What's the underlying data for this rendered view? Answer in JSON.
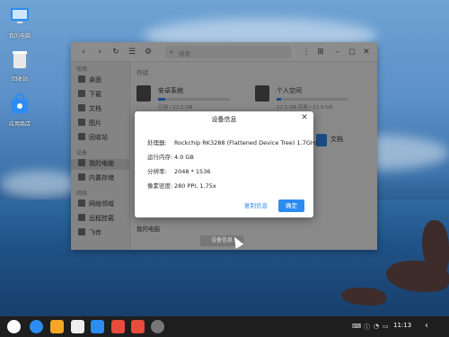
{
  "desktop": {
    "icons": [
      {
        "label": "我的电脑",
        "icon": "computer-icon"
      },
      {
        "label": "回收站",
        "icon": "trash-icon"
      },
      {
        "label": "应用商店",
        "icon": "app-store-icon"
      }
    ]
  },
  "file_manager": {
    "search_placeholder": "搜索",
    "sidebar": {
      "group_common": "常用",
      "items": [
        {
          "label": "桌面",
          "icon": "desktop-icon"
        },
        {
          "label": "下载",
          "icon": "download-icon"
        },
        {
          "label": "文档",
          "icon": "document-icon"
        },
        {
          "label": "图片",
          "icon": "picture-icon"
        },
        {
          "label": "回收站",
          "icon": "trash-icon"
        }
      ],
      "group_device": "设备",
      "device_items": [
        {
          "label": "我的电脑",
          "icon": "computer-icon",
          "active": true
        },
        {
          "label": "内置存储",
          "icon": "storage-icon"
        }
      ],
      "group_network": "网络",
      "network_items": [
        {
          "label": "网络领域",
          "icon": "network-icon"
        },
        {
          "label": "远程挂载",
          "icon": "remote-icon"
        },
        {
          "label": "飞传",
          "icon": "transfer-icon"
        }
      ]
    },
    "main": {
      "section_label": "存储",
      "disks": [
        {
          "name": "安卓系统",
          "capacity": "已用 / 22.5 GB",
          "usage": 0.1
        },
        {
          "name": "个人空间",
          "capacity": "22.5 GB 可用 / 23.9 GB",
          "usage": 0.06
        }
      ],
      "doc_label": "文档"
    },
    "status_text": "我的电脑",
    "tooltip": "设备信息"
  },
  "dialog": {
    "title": "设备信息",
    "rows": [
      {
        "key": "处理器:",
        "value": "Rockchip RK3288 (Flattened Device Tree) 1.7GHz"
      },
      {
        "key": "运行内存:",
        "value": "4.0 GB"
      },
      {
        "key": "分辨率:",
        "value": "2048 * 1536"
      },
      {
        "key": "像素密度:",
        "value": "280 PPI, 1.75x"
      }
    ],
    "copy_label": "复制信息",
    "ok_label": "确定"
  },
  "taskbar": {
    "apps": [
      "start-icon",
      "browser-icon",
      "file-manager-icon",
      "notes-icon",
      "wps-writer-icon",
      "wps-office-icon",
      "wps-pdf-icon",
      "settings-icon"
    ],
    "time": "11:13",
    "colors": {
      "accent": "#2d8cf0"
    }
  }
}
